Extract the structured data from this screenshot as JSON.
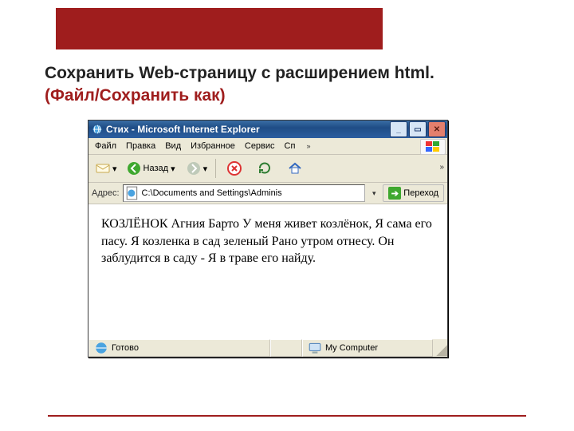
{
  "slide": {
    "heading_line1": "Сохранить  Web-страницу с расширением html.",
    "heading_line2": "(Файл/Сохранить как)"
  },
  "window": {
    "title": "Стих - Microsoft Internet Explorer",
    "menu": [
      "Файл",
      "Правка",
      "Вид",
      "Избранное",
      "Сервис",
      "Сп"
    ],
    "toolbar": {
      "back_label": "Назад"
    },
    "address": {
      "label": "Адрес:",
      "path": "C:\\Documents and Settings\\Adminis",
      "go_label": "Переход"
    },
    "content_text": "КОЗЛЁНОК Агния Барто У меня живет козлёнок, Я сама его пасу. Я козленка в сад зеленый Рано утром отнесу. Он заблудится в саду - Я в траве его найду.",
    "status": {
      "ready": "Готово",
      "zone": "My Computer"
    }
  }
}
